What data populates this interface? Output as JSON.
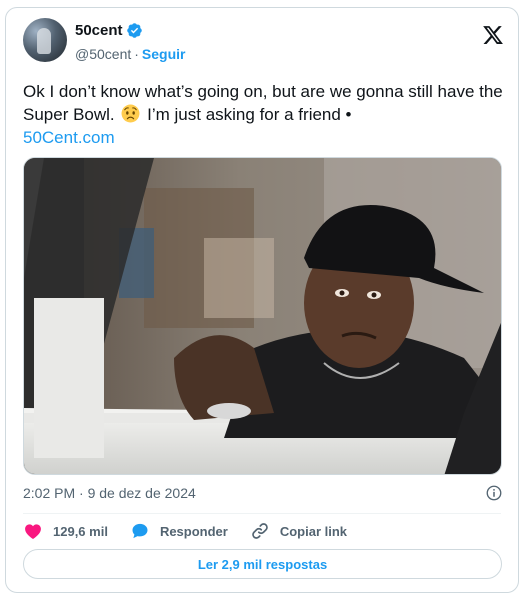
{
  "author": {
    "name": "50cent",
    "handle": "@50cent",
    "separator": "·",
    "follow_label": "Seguir"
  },
  "tweet": {
    "text_part1": "Ok I don’t know what’s going on, but are we gonna still have the Super Bowl.",
    "text_part2": "I’m just asking for a friend •",
    "link": "50Cent.com",
    "timestamp": "2:02 PM · 9 de dez de 2024"
  },
  "actions": {
    "likes_count": "129,6 mil",
    "reply_label": "Responder",
    "copy_link_label": "Copiar link",
    "read_replies_label": "Ler 2,9 mil respostas"
  },
  "icons": {
    "verified": "verified-badge-icon",
    "x_logo": "x-logo-icon",
    "emoji": "worried-face-emoji",
    "info": "info-icon",
    "like": "heart-icon",
    "reply": "speech-bubble-icon",
    "link": "link-icon"
  },
  "colors": {
    "accent": "#1d9bf0",
    "like": "#f91880",
    "text": "#0f1419",
    "muted": "#536471",
    "border": "#cfd9de"
  }
}
